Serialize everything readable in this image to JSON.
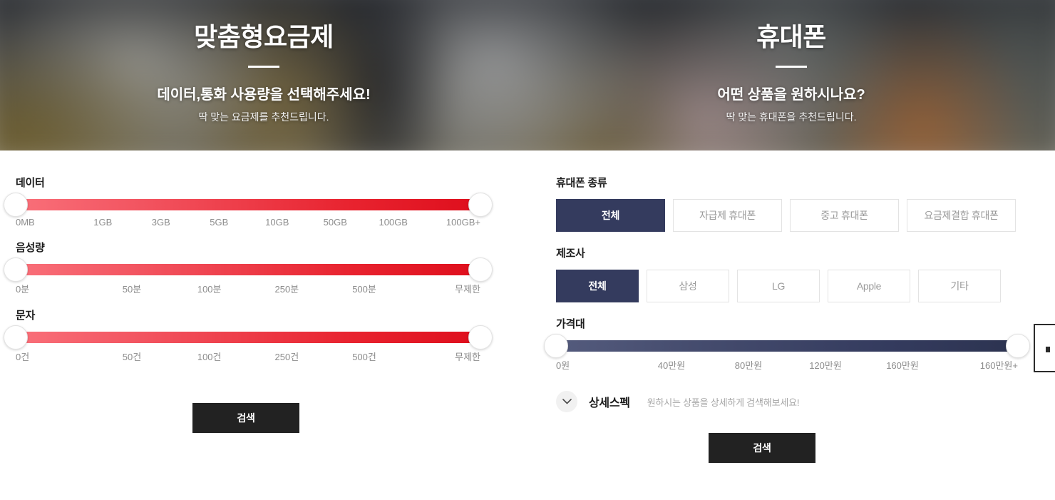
{
  "hero": {
    "left": {
      "title": "맞춤형요금제",
      "subtitle": "데이터,통화 사용량을 선택해주세요!",
      "description": "딱 맞는 요금제를 추천드립니다."
    },
    "right": {
      "title": "휴대폰",
      "subtitle": "어떤 상품을 원하시나요?",
      "description": "딱 맞는 휴대폰을 추천드립니다."
    }
  },
  "plan_panel": {
    "sliders": [
      {
        "label": "데이터",
        "ticks": [
          "0MB",
          "1GB",
          "3GB",
          "5GB",
          "10GB",
          "50GB",
          "100GB",
          "100GB+"
        ],
        "min_value": "0MB",
        "max_value": "100GB+",
        "track_color": "#e8232f"
      },
      {
        "label": "음성량",
        "ticks": [
          "0분",
          "50분",
          "100분",
          "250분",
          "500분",
          "무제한"
        ],
        "min_value": "0분",
        "max_value": "무제한",
        "track_color": "#e8232f"
      },
      {
        "label": "문자",
        "ticks": [
          "0건",
          "50건",
          "100건",
          "250건",
          "500건",
          "무제한"
        ],
        "min_value": "0건",
        "max_value": "무제한",
        "track_color": "#e8232f"
      }
    ],
    "search_label": "검색"
  },
  "phone_panel": {
    "phone_type": {
      "label": "휴대폰 종류",
      "options": [
        "전체",
        "자급제 휴대폰",
        "중고 휴대폰",
        "요금제결합 휴대폰"
      ],
      "selected": "전체"
    },
    "manufacturer": {
      "label": "제조사",
      "options": [
        "전체",
        "삼성",
        "LG",
        "Apple",
        "기타"
      ],
      "selected": "전체"
    },
    "price_slider": {
      "label": "가격대",
      "ticks": [
        "0원",
        "40만원",
        "80만원",
        "120만원",
        "160만원",
        "160만원+"
      ],
      "min_value": "0원",
      "max_value": "160만원+",
      "track_color": "#343b5e"
    },
    "detail_spec": {
      "icon": "chevron-down-icon",
      "title": "상세스펙",
      "hint": "원하시는 상품을 상세하게 검색해보세요!"
    },
    "search_label": "검색"
  },
  "theme": {
    "accent_red": "#e8232f",
    "accent_navy": "#343b5e",
    "button_black": "#222222",
    "tick_gray": "#8c8c8c"
  }
}
